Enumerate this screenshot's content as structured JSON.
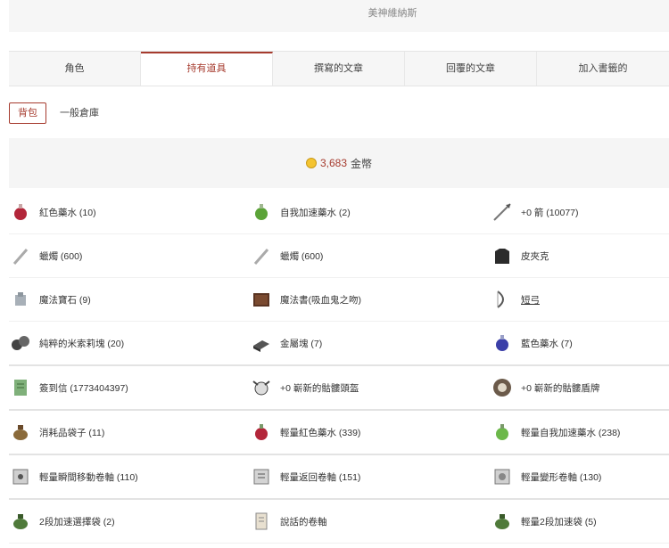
{
  "header": {
    "title": "",
    "subtitle": "美神維納斯"
  },
  "tabs": [
    "角色",
    "持有道具",
    "撰寫的文章",
    "回覆的文章",
    "加入書籤的"
  ],
  "active_tab_index": 1,
  "sub_tabs": [
    "背包",
    "一般倉庫"
  ],
  "gold": {
    "amount": "3,683",
    "unit": "金幣"
  },
  "items": [
    [
      {
        "icon": "red-potion-icon",
        "label": "紅色藥水 (10)"
      },
      {
        "icon": "green-potion-icon",
        "label": "自我加速藥水 (2)"
      },
      {
        "icon": "arrow-icon",
        "label": "+0 箭 (10077)"
      }
    ],
    [
      {
        "icon": "candle-icon",
        "label": "蠟燭 (600)"
      },
      {
        "icon": "candle-icon",
        "label": "蠟燭 (600)"
      },
      {
        "icon": "leather-jacket-icon",
        "label": "皮夾克"
      }
    ],
    [
      {
        "icon": "magic-stone-icon",
        "label": "魔法寶石 (9)"
      },
      {
        "icon": "spellbook-icon",
        "label": "魔法書(吸血鬼之吻)"
      },
      {
        "icon": "short-bow-icon",
        "label": "短弓"
      }
    ],
    [
      {
        "icon": "mithril-ore-icon",
        "label": "純粹的米索莉塊 (20)"
      },
      {
        "icon": "metal-block-icon",
        "label": "金屬塊 (7)"
      },
      {
        "icon": "blue-potion-icon",
        "label": "藍色藥水 (7)"
      }
    ],
    [
      {
        "icon": "signin-letter-icon",
        "label": "簽到信 (1773404397)"
      },
      {
        "icon": "skull-helmet-icon",
        "label": "+0 嶄新的骷髏頭盔"
      },
      {
        "icon": "skull-shield-icon",
        "label": "+0 嶄新的骷髏盾牌"
      }
    ],
    [
      {
        "icon": "consumable-bag-icon",
        "label": "消耗品袋子 (11)"
      },
      {
        "icon": "light-red-potion-icon",
        "label": "輕量紅色藥水 (339)"
      },
      {
        "icon": "light-green-potion-icon",
        "label": "輕量自我加速藥水 (238)"
      }
    ],
    [
      {
        "icon": "teleport-scroll-icon",
        "label": "輕量瞬間移動卷軸 (110)"
      },
      {
        "icon": "return-scroll-icon",
        "label": "輕量返回卷軸 (151)"
      },
      {
        "icon": "polymorph-scroll-icon",
        "label": "輕量變形卷軸 (130)"
      }
    ],
    [
      {
        "icon": "haste-select-bag-icon",
        "label": "2段加速選擇袋 (2)"
      },
      {
        "icon": "speech-scroll-icon",
        "label": "說話的卷軸"
      },
      {
        "icon": "haste-bag-icon",
        "label": "輕量2段加速袋 (5)"
      }
    ]
  ]
}
